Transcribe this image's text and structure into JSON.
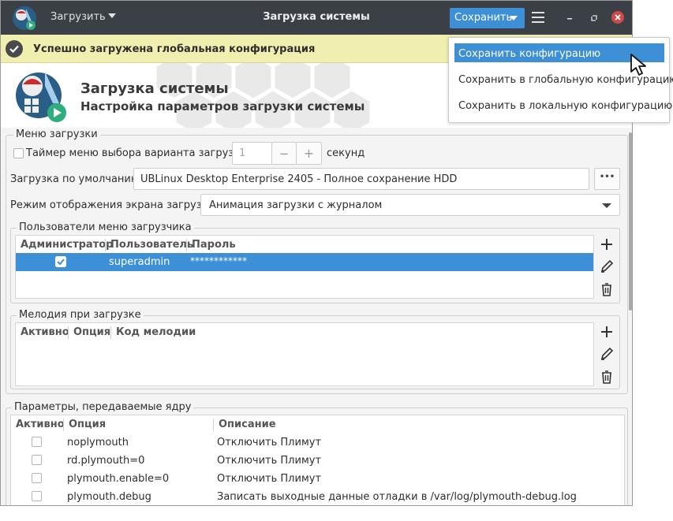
{
  "window": {
    "title": "Загрузка системы",
    "load_menu": "Загрузить",
    "save_button": "Сохранить"
  },
  "infobar": {
    "message": "Успешно загружена глобальная конфигурация"
  },
  "header": {
    "title": "Загрузка системы",
    "subtitle": "Настройка параметров загрузки системы"
  },
  "boot_menu": {
    "label": "Меню загрузки",
    "timer_label": "Таймер меню выбора варианта загрузки:",
    "timer_checked": false,
    "timer_value": "1",
    "timer_minus": "−",
    "timer_plus": "+",
    "timer_unit": "секунд",
    "default_label": "Загрузка по умолчанию:",
    "default_value": "UBLinux Desktop Enterprise 2405 - Полное сохранение HDD",
    "default_more": "•••",
    "mode_label": "Режим отображения экрана загрузки:",
    "mode_value": "Анимация загрузки с журналом"
  },
  "users": {
    "label": "Пользователи меню загрузчика",
    "columns": [
      "Администратор",
      "Пользователь",
      "Пароль"
    ],
    "rows": [
      {
        "admin": true,
        "user": "superadmin",
        "password": "************",
        "selected": true
      }
    ]
  },
  "melody": {
    "label": "Мелодия при загрузке",
    "columns": [
      "Активно",
      "Опция",
      "Код мелодии"
    ],
    "rows": []
  },
  "kernel": {
    "label": "Параметры, передаваемые ядру",
    "columns": [
      "Активно",
      "Опция",
      "Описание"
    ],
    "rows": [
      {
        "active": false,
        "option": "noplymouth",
        "description": "Отключить Плимут"
      },
      {
        "active": false,
        "option": "rd.plymouth=0",
        "description": "Отключить Плимут"
      },
      {
        "active": false,
        "option": "plymouth.enable=0",
        "description": "Отключить Плимут"
      },
      {
        "active": false,
        "option": "plymouth.debug",
        "description": "Записать выходные данные отладки в /var/log/plymouth-debug.log"
      }
    ]
  },
  "save_menu": {
    "items": [
      "Сохранить конфигурацию",
      "Сохранить в глобальную конфигурацию",
      "Сохранить в локальную конфигурацию"
    ],
    "highlighted": 0
  },
  "colors": {
    "titlebar": "#3b4046",
    "accent": "#3d8fd6",
    "infobar": "#f0efb0",
    "close": "#d04a49"
  }
}
